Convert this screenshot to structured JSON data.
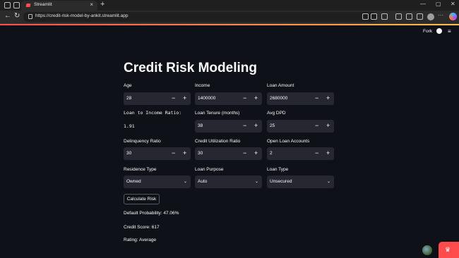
{
  "browser": {
    "tab_title": "Streamlit",
    "tab_close": "×",
    "new_tab": "+",
    "url": "https://credit-risk-model-by-ankit.streamlit.app",
    "back": "←",
    "reload": "↻",
    "minimize": "—",
    "maximize": "▢",
    "close": "✕"
  },
  "header": {
    "fork_label": "Fork",
    "menu": "≡"
  },
  "app": {
    "title": "Credit Risk Modeling",
    "fields": {
      "age": {
        "label": "Age",
        "value": "28"
      },
      "income": {
        "label": "Income",
        "value": "1400000"
      },
      "loan_amount": {
        "label": "Loan Amount",
        "value": "2680000"
      },
      "loan_tenure": {
        "label": "Loan Tenure (months)",
        "value": "38"
      },
      "avg_dpd": {
        "label": "Avg DPD",
        "value": "25"
      },
      "delinquency_ratio": {
        "label": "Delinquency Ratio",
        "value": "30"
      },
      "credit_utilization": {
        "label": "Credit Utilization Ratio",
        "value": "30"
      },
      "open_loan_accounts": {
        "label": "Open Loan Accounts",
        "value": "2"
      }
    },
    "stepper": {
      "minus": "−",
      "plus": "+"
    },
    "ratio": {
      "label": "Loan to Income Ratio:",
      "value": "1.91"
    },
    "selects": {
      "residence_type": {
        "label": "Residence Type",
        "value": "Owned"
      },
      "loan_purpose": {
        "label": "Loan Purpose",
        "value": "Auto"
      },
      "loan_type": {
        "label": "Loan Type",
        "value": "Unsecured"
      }
    },
    "chevron": "⌄",
    "calculate_button": "Calculate Risk",
    "results": {
      "probability": "Default Probability: 47.06%",
      "credit_score": "Credit Score: 617",
      "rating": "Rating: Average"
    },
    "badge_icon": "♛"
  }
}
